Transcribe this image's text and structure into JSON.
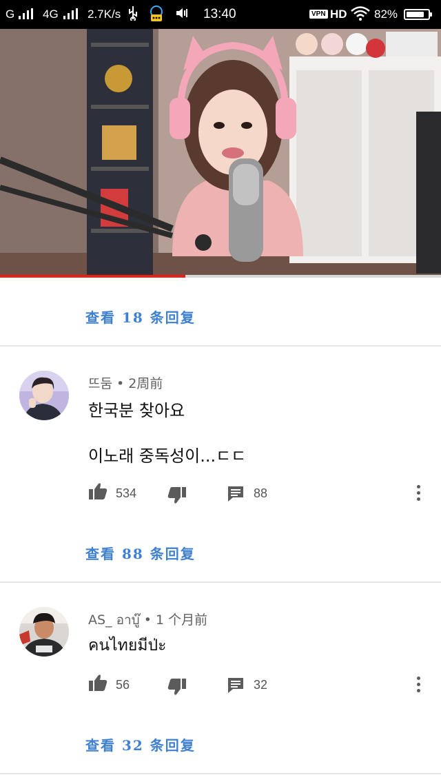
{
  "status_bar": {
    "carrier_label": "G",
    "network_label": "4G",
    "speed": "2.7K/s",
    "time": "13:40",
    "vpn_label": "VPN",
    "hd_label": "HD",
    "battery_percent": "82%",
    "battery_level": 0.82
  },
  "video": {
    "progress": 0.42
  },
  "thread_top": {
    "view_replies": "查看 18 条回复"
  },
  "comments": [
    {
      "author": "뜨둠",
      "time": "2周前",
      "lines": [
        "한국분 찾아요",
        "이노래 중독성이...ㄷㄷ"
      ],
      "likes": "534",
      "replies": "88",
      "view_replies": "查看 88 条回复"
    },
    {
      "author": "AS_ อาบู๊",
      "time": "1 个月前",
      "lines": [
        "คนไทยมีป่ะ"
      ],
      "likes": "56",
      "replies": "32",
      "view_replies": "查看 32 条回复"
    }
  ],
  "colors": {
    "link": "#3f80d0",
    "progress": "#e62117",
    "icon": "#5b5b5b"
  }
}
